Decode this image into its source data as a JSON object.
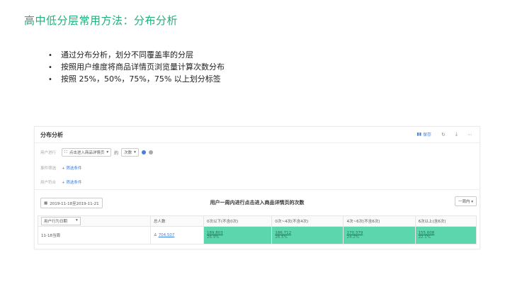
{
  "slide": {
    "title": "高中低分层常用方法：分布分析",
    "bullets": [
      "通过分布分析，划分不同覆盖率的分层",
      "按照用户维度将商品详情页浏览量计算次数分布",
      "按照 25%，50%，75%，75% 以上划分标签"
    ],
    "bullet_glyph": "•"
  },
  "app": {
    "title": "分布分析",
    "save_label": "保存",
    "icons": [
      "save-icon",
      "refresh-icon",
      "download-icon",
      "more-icon"
    ],
    "filters": {
      "user_label": "用户进行",
      "event_select": "点击进入商品详情页",
      "of_label": "的",
      "metric_select": "次数",
      "event_filter_label": "事件筛选",
      "event_filter_link": "+ 筛选条件",
      "user_filter_label": "用户符合",
      "user_filter_link": "+ 筛选条件"
    },
    "date_range": "2019-11-18至2019-11-21",
    "chart_title": "用户一周内进行点击进入商品详情页的次数",
    "period_select": "一周内",
    "table": {
      "group_select": "用户行为日期",
      "headers": [
        "总人数",
        "0次以下(不含0次)",
        "0次~4次(不含4次)",
        "4次~6次(不含6次)",
        "6次以上(含6次)"
      ],
      "rows": [
        {
          "label": "11-18当周",
          "total": "704,507",
          "cells": [
            {
              "value": "189,803",
              "pct": "26.9%"
            },
            {
              "value": "186,712",
              "pct": "26.5%"
            },
            {
              "value": "170,379",
              "pct": "24.2%"
            },
            {
              "value": "155,608",
              "pct": "22.1%"
            }
          ]
        }
      ]
    },
    "accent_color": "#5cd6ad",
    "title_color": "#21b07a"
  }
}
